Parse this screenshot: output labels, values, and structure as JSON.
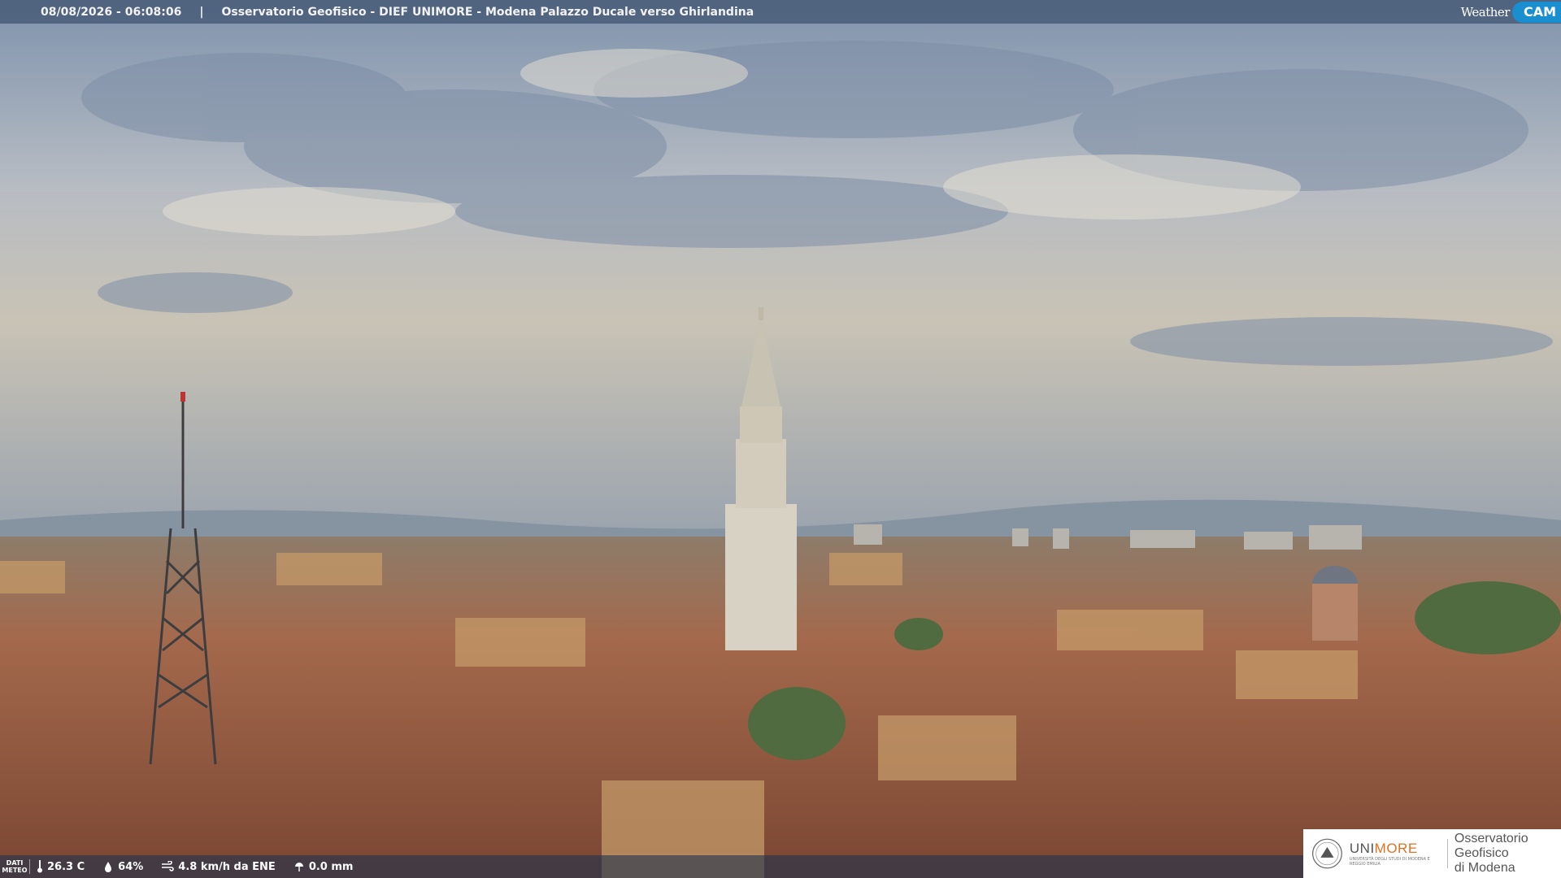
{
  "overlay": {
    "timestamp": "08/08/2026 - 06:08:06",
    "separator": "|",
    "title": "Osservatorio Geofisico - DIEF UNIMORE - Modena Palazzo Ducale verso Ghirlandina",
    "brand_word": "Weather",
    "brand_cam": "CAM"
  },
  "weather": {
    "label": "DATI METEO",
    "temperature": "26.3 C",
    "humidity": "64%",
    "wind": "4.8 km/h da ENE",
    "rain": "0.0 mm"
  },
  "logo": {
    "uni_a": "UNI",
    "uni_b": "MORE",
    "uni_sub": "UNIVERSITÀ DEGLI STUDI DI MODENA E REGGIO EMILIA",
    "observatory_line1": "Osservatorio Geofisico",
    "observatory_line2": "di Modena"
  },
  "colors": {
    "sky_top": "#7f93ad",
    "sky_haze": "#c9c3b5",
    "roofs": "#9a5a40",
    "walls": "#c9a26b",
    "tower": "#d8d2c4",
    "accent": "#1a8fd0"
  }
}
